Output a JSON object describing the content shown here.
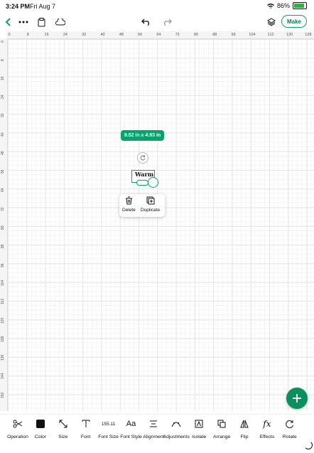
{
  "status_bar": {
    "time": "3:24 PM",
    "date": "Fri Aug 7",
    "battery_text": "86%",
    "battery_level": 0.86
  },
  "toolbar": {
    "make_label": "Make"
  },
  "rulers": {
    "top": [
      "0",
      "8",
      "16",
      "24",
      "32",
      "40",
      "48",
      "56",
      "64",
      "72",
      "80",
      "88",
      "96",
      "104",
      "112",
      "120",
      "128"
    ],
    "left": [
      "0",
      "8",
      "16",
      "24",
      "32",
      "40",
      "48",
      "56",
      "64",
      "72",
      "80",
      "88",
      "96",
      "104",
      "112",
      "120",
      "128",
      "136",
      "144",
      "152"
    ]
  },
  "canvas": {
    "dimensions": "9.52 in x 4.93 in",
    "text_content": "Warm"
  },
  "context_menu": {
    "delete_label": "Delete",
    "duplicate_label": "Duplicate"
  },
  "bottom_tools": [
    {
      "label": "Operation",
      "icon": "operation-icon"
    },
    {
      "label": "Color",
      "icon": "color-swatch-icon"
    },
    {
      "label": "Size",
      "icon": "size-icon"
    },
    {
      "label": "Font",
      "icon": "font-icon"
    },
    {
      "label": "Font Size",
      "icon": "font-size-value",
      "value": "155.11"
    },
    {
      "label": "Font Style",
      "icon": "font-style-icon",
      "glyph": "Aa"
    },
    {
      "label": "Alignment",
      "icon": "alignment-icon"
    },
    {
      "label": "Adjustments",
      "icon": "adjustments-icon"
    },
    {
      "label": "Isolate",
      "icon": "isolate-icon"
    },
    {
      "label": "Arrange",
      "icon": "arrange-icon"
    },
    {
      "label": "Flip",
      "icon": "flip-icon"
    },
    {
      "label": "Effects",
      "icon": "effects-icon"
    },
    {
      "label": "Rotate",
      "icon": "rotate-icon"
    }
  ],
  "colors": {
    "accent": "#08a36c",
    "fab": "#0a8f5e"
  }
}
